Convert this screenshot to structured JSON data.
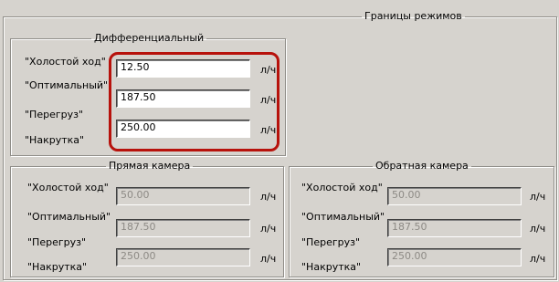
{
  "main_group": {
    "title": "Границы режимов"
  },
  "differential": {
    "title": "Дифференциальный",
    "rows": [
      {
        "label": "\"Холостой ход\"",
        "value": "12.50",
        "unit": "л/ч"
      },
      {
        "label": "\"Оптимальный\"",
        "value": "187.50",
        "unit": "л/ч"
      },
      {
        "label": "\"Перегруз\"",
        "value": "250.00",
        "unit": "л/ч"
      },
      {
        "label": "\"Накрутка\""
      }
    ]
  },
  "direct_chamber": {
    "title": "Прямая камера",
    "rows": [
      {
        "label": "\"Холостой ход\"",
        "value": "50.00",
        "unit": "л/ч"
      },
      {
        "label": "\"Оптимальный\"",
        "value": "187.50",
        "unit": "л/ч"
      },
      {
        "label": "\"Перегруз\"",
        "value": "250.00",
        "unit": "л/ч"
      },
      {
        "label": "\"Накрутка\""
      }
    ]
  },
  "reverse_chamber": {
    "title": "Обратная камера",
    "rows": [
      {
        "label": "\"Холостой ход\"",
        "value": "50.00",
        "unit": "л/ч"
      },
      {
        "label": "\"Оптимальный\"",
        "value": "187.50",
        "unit": "л/ч"
      },
      {
        "label": "\"Перегруз\"",
        "value": "250.00",
        "unit": "л/ч"
      },
      {
        "label": "\"Накрутка\""
      }
    ]
  },
  "colors": {
    "highlight": "#b7120c",
    "panel": "#d6d3ce"
  }
}
